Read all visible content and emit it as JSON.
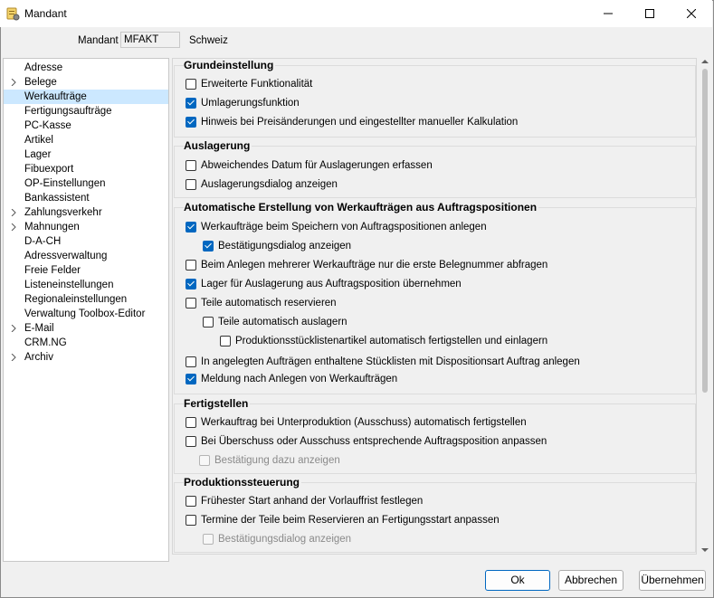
{
  "window": {
    "title": "Mandant"
  },
  "header": {
    "mandant_label": "Mandant",
    "mandant_code": "MFAKT",
    "mandant_name": "Schweiz"
  },
  "sidebar": {
    "items": [
      {
        "label": "Adresse",
        "expandable": false,
        "selected": false
      },
      {
        "label": "Belege",
        "expandable": true,
        "selected": false
      },
      {
        "label": "Werkaufträge",
        "expandable": false,
        "selected": true
      },
      {
        "label": "Fertigungsaufträge",
        "expandable": false,
        "selected": false
      },
      {
        "label": "PC-Kasse",
        "expandable": false,
        "selected": false
      },
      {
        "label": "Artikel",
        "expandable": false,
        "selected": false
      },
      {
        "label": "Lager",
        "expandable": false,
        "selected": false
      },
      {
        "label": "Fibuexport",
        "expandable": false,
        "selected": false
      },
      {
        "label": "OP-Einstellungen",
        "expandable": false,
        "selected": false
      },
      {
        "label": "Bankassistent",
        "expandable": false,
        "selected": false
      },
      {
        "label": "Zahlungsverkehr",
        "expandable": true,
        "selected": false
      },
      {
        "label": "Mahnungen",
        "expandable": true,
        "selected": false
      },
      {
        "label": "D-A-CH",
        "expandable": false,
        "selected": false
      },
      {
        "label": "Adressverwaltung",
        "expandable": false,
        "selected": false
      },
      {
        "label": "Freie Felder",
        "expandable": false,
        "selected": false
      },
      {
        "label": "Listeneinstellungen",
        "expandable": false,
        "selected": false
      },
      {
        "label": "Regionaleinstellungen",
        "expandable": false,
        "selected": false
      },
      {
        "label": "Verwaltung Toolbox-Editor",
        "expandable": false,
        "selected": false
      },
      {
        "label": "E-Mail",
        "expandable": true,
        "selected": false
      },
      {
        "label": "CRM.NG",
        "expandable": false,
        "selected": false
      },
      {
        "label": "Archiv",
        "expandable": true,
        "selected": false
      }
    ]
  },
  "groups": {
    "grundeinstellung": {
      "title": "Grundeinstellung",
      "options": [
        {
          "label": "Erweiterte Funktionalität",
          "checked": false,
          "disabled": false
        },
        {
          "label": "Umlagerungsfunktion",
          "checked": true,
          "disabled": false
        },
        {
          "label": "Hinweis bei Preisänderungen und eingestellter manueller Kalkulation",
          "checked": true,
          "disabled": false
        }
      ]
    },
    "auslagerung": {
      "title": "Auslagerung",
      "options": [
        {
          "label": "Abweichendes Datum für Auslagerungen erfassen",
          "checked": false,
          "disabled": false
        },
        {
          "label": "Auslagerungsdialog anzeigen",
          "checked": false,
          "disabled": false
        }
      ]
    },
    "automatisch": {
      "title": "Automatische Erstellung von Werkaufträgen aus Auftragspositionen",
      "options": [
        {
          "label": "Werkaufträge beim Speichern von Auftragspositionen anlegen",
          "checked": true,
          "disabled": false
        },
        {
          "label": "Bestätigungsdialog anzeigen",
          "checked": true,
          "disabled": false
        },
        {
          "label": "Beim Anlegen mehrerer Werkaufträge nur die erste Belegnummer abfragen",
          "checked": false,
          "disabled": false
        },
        {
          "label": "Lager für Auslagerung aus Auftragsposition übernehmen",
          "checked": true,
          "disabled": false
        },
        {
          "label": "Teile automatisch reservieren",
          "checked": false,
          "disabled": false
        },
        {
          "label": "Teile automatisch auslagern",
          "checked": false,
          "disabled": false
        },
        {
          "label": "Produktionsstücklistenartikel automatisch fertigstellen und einlagern",
          "checked": false,
          "disabled": false
        },
        {
          "label": "In angelegten Aufträgen enthaltene Stücklisten mit Dispositionsart Auftrag anlegen",
          "checked": false,
          "disabled": false
        },
        {
          "label": "Meldung nach Anlegen von Werkaufträgen",
          "checked": true,
          "disabled": false
        }
      ]
    },
    "fertigstellen": {
      "title": "Fertigstellen",
      "options": [
        {
          "label": "Werkauftrag bei Unterproduktion (Ausschuss) automatisch fertigstellen",
          "checked": false,
          "disabled": false
        },
        {
          "label": "Bei Überschuss oder Ausschuss entsprechende Auftragsposition anpassen",
          "checked": false,
          "disabled": false
        },
        {
          "label": "Bestätigung dazu anzeigen",
          "checked": false,
          "disabled": true
        }
      ]
    },
    "produktion": {
      "title": "Produktionssteuerung",
      "options": [
        {
          "label": "Frühester Start anhand der Vorlauffrist festlegen",
          "checked": false,
          "disabled": false
        },
        {
          "label": "Termine der Teile beim Reservieren an Fertigungsstart anpassen",
          "checked": false,
          "disabled": false
        },
        {
          "label": "Bestätigungsdialog anzeigen",
          "checked": false,
          "disabled": true
        }
      ]
    }
  },
  "footer": {
    "ok_label": "Ok",
    "cancel_label": "Abbrechen",
    "apply_label": "Übernehmen"
  },
  "colors": {
    "accent": "#0067c0",
    "selection": "#cce8ff"
  }
}
